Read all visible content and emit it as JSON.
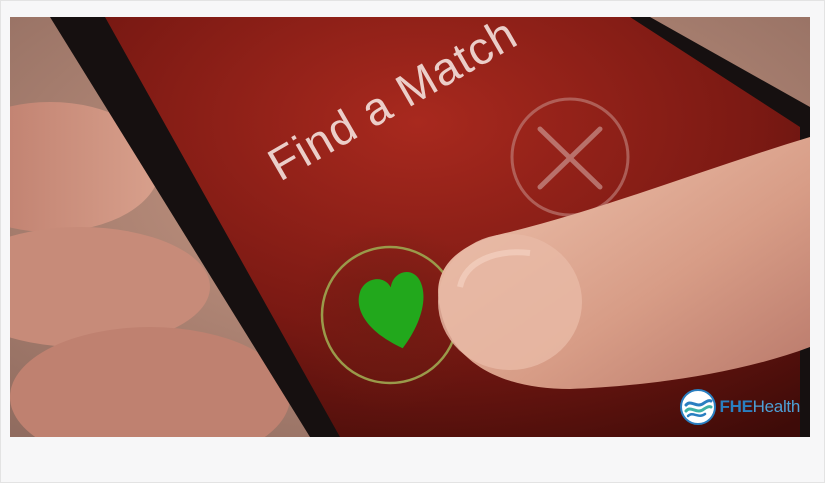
{
  "screen": {
    "headline": "Find a Match"
  },
  "logo": {
    "brand_bold": "FHE",
    "brand_light": "Health"
  },
  "colors": {
    "phone_screen": "#8a1f18",
    "heart": "#22a81c",
    "ring": "#9a9a4a",
    "skin": "#d9a894",
    "brand_blue": "#2a7fc1"
  }
}
